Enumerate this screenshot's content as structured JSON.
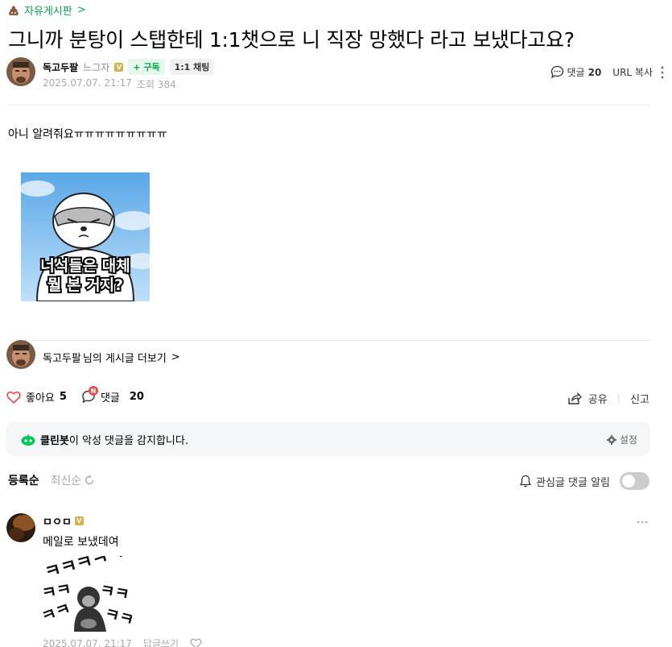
{
  "board": {
    "name": "자유게시판",
    "chevron": ">"
  },
  "post": {
    "title": "그니까 분탕이 스탭한테 1:1챗으로 니 직장 망했다 라고 보냈다고요?",
    "author": "독고두팔",
    "grade": "느그자",
    "verified_badge": "V",
    "subscribe_label": "+ 구독",
    "chat_label": "1:1 채팅",
    "date": "2025.07.07. 21:17",
    "views_label": "조회 384",
    "comments_label": "댓글",
    "comments_count": "20",
    "url_copy_label": "URL 복사",
    "body": "아니 알려줘요ㅠㅠㅠㅠㅠㅠㅠㅠㅠ",
    "image_caption_lines": [
      "너석들은 대체",
      "뭘 본 거지?"
    ]
  },
  "more_posts": {
    "author": "독고두팔",
    "suffix": "님의 게시글 더보기",
    "chevron": ">"
  },
  "actions": {
    "like_label": "좋아요",
    "like_count": "5",
    "comment_label": "댓글",
    "comment_count": "20",
    "new_badge": "N",
    "share_label": "공유",
    "report_label": "신고"
  },
  "cleanbot": {
    "name": "클린봇",
    "message": "이 악성 댓글을 감지합니다.",
    "setting_label": "설정"
  },
  "sort": {
    "registered": "등록순",
    "latest": "최신순"
  },
  "notify": {
    "label": "관심글 댓글 알림",
    "enabled": false
  },
  "comments": [
    {
      "author": "ㅁㅇㅁ",
      "badge": "V",
      "text": "메일로 보냈데여",
      "date": "2025.07.07. 21:17",
      "reply_label": "답글쓰기",
      "sticker_text": "ㅋㅋㅋㅋㅋㅋㅋ"
    }
  ],
  "colors": {
    "accent": "#03a94b",
    "heart": "#e84c4c",
    "badge_gold": "#d6b14c"
  }
}
